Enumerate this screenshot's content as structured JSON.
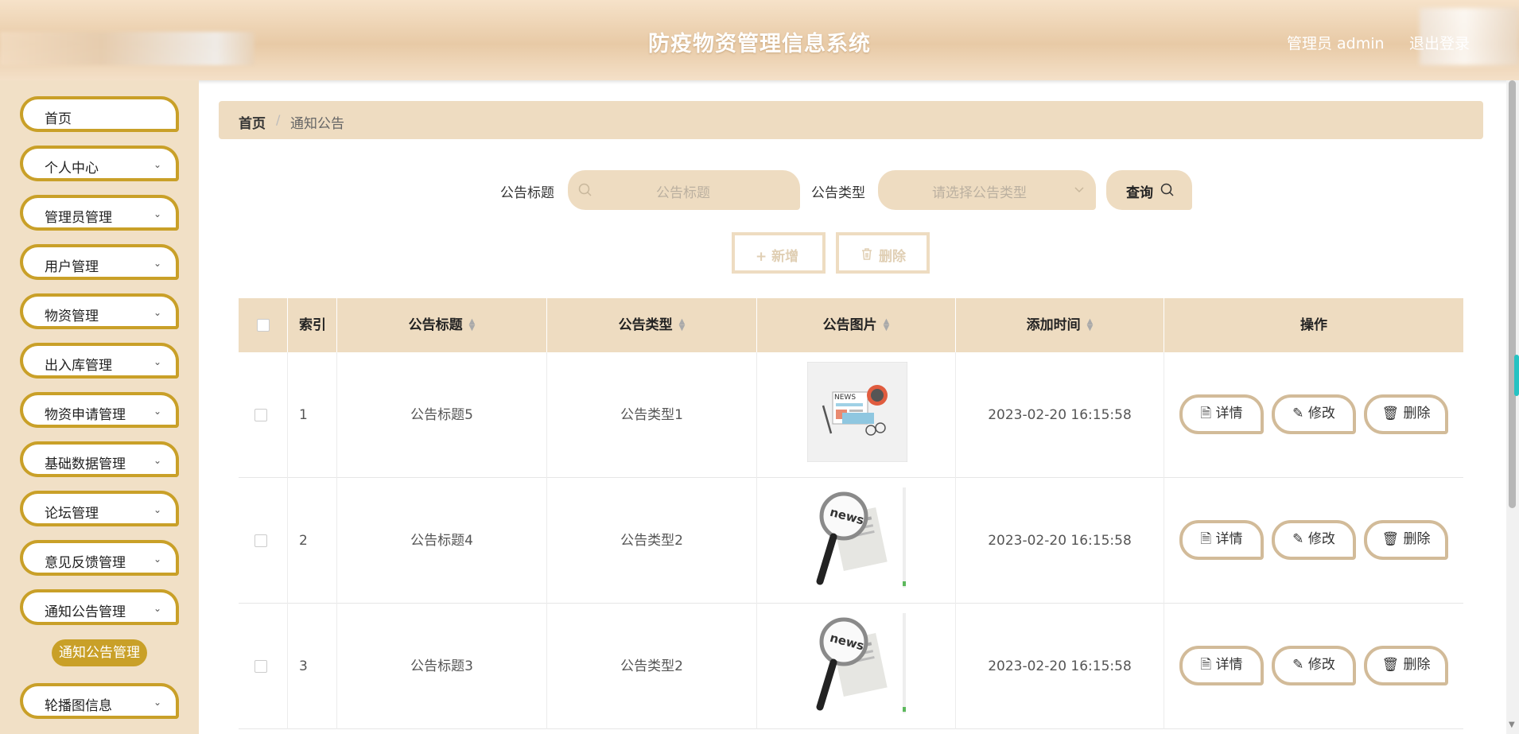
{
  "header": {
    "title": "防疫物资管理信息系统",
    "user_label": "管理员 admin",
    "logout_label": "退出登录"
  },
  "sidebar": {
    "items": [
      {
        "label": "首页",
        "has_children": false
      },
      {
        "label": "个人中心",
        "has_children": true
      },
      {
        "label": "管理员管理",
        "has_children": true
      },
      {
        "label": "用户管理",
        "has_children": true
      },
      {
        "label": "物资管理",
        "has_children": true
      },
      {
        "label": "出入库管理",
        "has_children": true
      },
      {
        "label": "物资申请管理",
        "has_children": true
      },
      {
        "label": "基础数据管理",
        "has_children": true
      },
      {
        "label": "论坛管理",
        "has_children": true
      },
      {
        "label": "意见反馈管理",
        "has_children": true
      },
      {
        "label": "通知公告管理",
        "has_children": true,
        "expanded": true
      },
      {
        "label": "轮播图信息",
        "has_children": true
      }
    ],
    "active_subitem": "通知公告管理"
  },
  "breadcrumb": {
    "home": "首页",
    "separator": "/",
    "current": "通知公告"
  },
  "search": {
    "title_label": "公告标题",
    "title_placeholder": "公告标题",
    "type_label": "公告类型",
    "type_placeholder": "请选择公告类型",
    "query_label": "查询"
  },
  "actions": {
    "add_label": "+ 新增",
    "delete_label": "删除"
  },
  "table": {
    "headers": [
      "索引",
      "公告标题",
      "公告类型",
      "公告图片",
      "添加时间",
      "操作"
    ],
    "rows": [
      {
        "index": "1",
        "title": "公告标题5",
        "type": "公告类型1",
        "image": "news-paper-illustration",
        "time": "2023-02-20 16:15:58"
      },
      {
        "index": "2",
        "title": "公告标题4",
        "type": "公告类型2",
        "image": "news-magnifier-illustration",
        "time": "2023-02-20 16:15:58"
      },
      {
        "index": "3",
        "title": "公告标题3",
        "type": "公告类型2",
        "image": "news-magnifier-illustration",
        "time": "2023-02-20 16:15:58"
      }
    ],
    "ops": {
      "detail": "详情",
      "edit": "修改",
      "delete": "删除"
    }
  },
  "colors": {
    "accent_gold": "#c9a028",
    "panel_beige": "#eedcc1",
    "sidebar_bg": "#f1e0c6"
  }
}
